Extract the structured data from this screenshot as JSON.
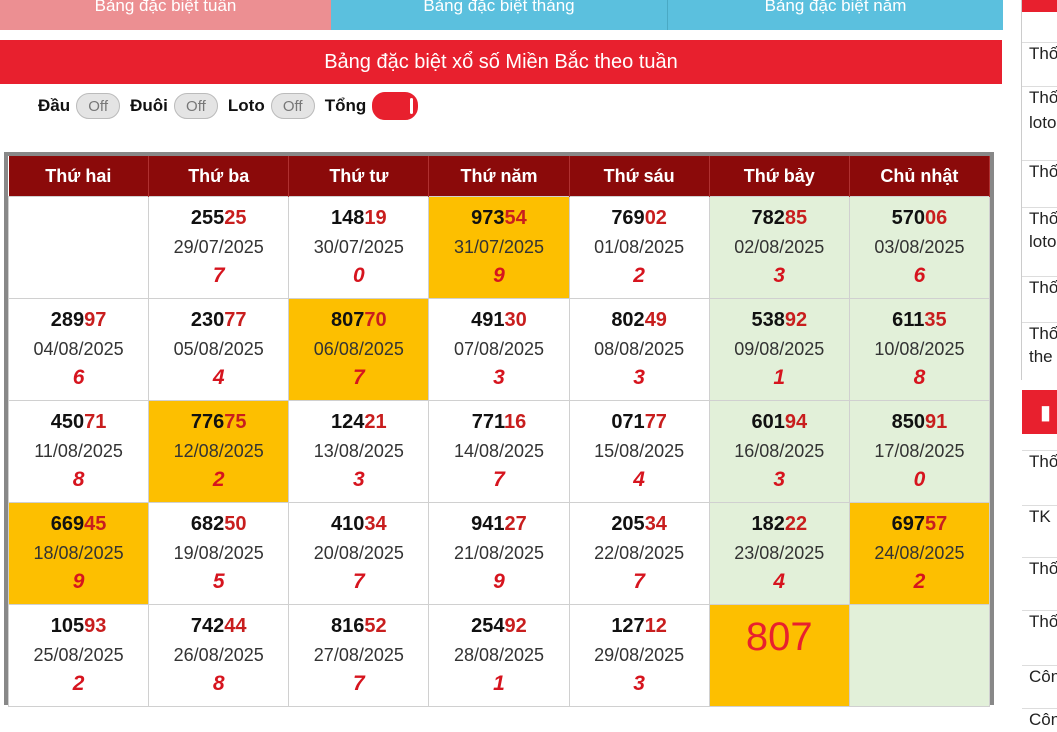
{
  "tabs": [
    {
      "label": "Bảng đặc biệt tuần"
    },
    {
      "label": "Bảng đặc biệt tháng"
    },
    {
      "label": "Bảng đặc biệt năm"
    }
  ],
  "title": "Bảng đặc biệt xổ số Miền Bắc theo tuần",
  "toggles": {
    "dau": {
      "label": "Đầu",
      "state": "Off"
    },
    "duoi": {
      "label": "Đuôi",
      "state": "Off"
    },
    "loto": {
      "label": "Loto",
      "state": "Off"
    },
    "tong": {
      "label": "Tổng",
      "state": "On"
    }
  },
  "headers": [
    "Thứ hai",
    "Thứ ba",
    "Thứ tư",
    "Thứ năm",
    "Thứ sáu",
    "Thứ bảy",
    "Chủ nhật"
  ],
  "rows": [
    [
      {
        "empty": true
      },
      {
        "head": "255",
        "tail": "25",
        "date": "29/07/2025",
        "sum": "7"
      },
      {
        "head": "148",
        "tail": "19",
        "date": "30/07/2025",
        "sum": "0"
      },
      {
        "head": "973",
        "tail": "54",
        "date": "31/07/2025",
        "sum": "9",
        "hl": true
      },
      {
        "head": "769",
        "tail": "02",
        "date": "01/08/2025",
        "sum": "2"
      },
      {
        "head": "782",
        "tail": "85",
        "date": "02/08/2025",
        "sum": "3"
      },
      {
        "head": "570",
        "tail": "06",
        "date": "03/08/2025",
        "sum": "6"
      }
    ],
    [
      {
        "head": "289",
        "tail": "97",
        "date": "04/08/2025",
        "sum": "6"
      },
      {
        "head": "230",
        "tail": "77",
        "date": "05/08/2025",
        "sum": "4"
      },
      {
        "head": "807",
        "tail": "70",
        "date": "06/08/2025",
        "sum": "7",
        "hl": true
      },
      {
        "head": "491",
        "tail": "30",
        "date": "07/08/2025",
        "sum": "3"
      },
      {
        "head": "802",
        "tail": "49",
        "date": "08/08/2025",
        "sum": "3"
      },
      {
        "head": "538",
        "tail": "92",
        "date": "09/08/2025",
        "sum": "1"
      },
      {
        "head": "611",
        "tail": "35",
        "date": "10/08/2025",
        "sum": "8"
      }
    ],
    [
      {
        "head": "450",
        "tail": "71",
        "date": "11/08/2025",
        "sum": "8"
      },
      {
        "head": "776",
        "tail": "75",
        "date": "12/08/2025",
        "sum": "2",
        "hl": true
      },
      {
        "head": "124",
        "tail": "21",
        "date": "13/08/2025",
        "sum": "3"
      },
      {
        "head": "771",
        "tail": "16",
        "date": "14/08/2025",
        "sum": "7"
      },
      {
        "head": "071",
        "tail": "77",
        "date": "15/08/2025",
        "sum": "4"
      },
      {
        "head": "601",
        "tail": "94",
        "date": "16/08/2025",
        "sum": "3"
      },
      {
        "head": "850",
        "tail": "91",
        "date": "17/08/2025",
        "sum": "0"
      }
    ],
    [
      {
        "head": "669",
        "tail": "45",
        "date": "18/08/2025",
        "sum": "9",
        "hl": true
      },
      {
        "head": "682",
        "tail": "50",
        "date": "19/08/2025",
        "sum": "5"
      },
      {
        "head": "410",
        "tail": "34",
        "date": "20/08/2025",
        "sum": "7"
      },
      {
        "head": "941",
        "tail": "27",
        "date": "21/08/2025",
        "sum": "9"
      },
      {
        "head": "205",
        "tail": "34",
        "date": "22/08/2025",
        "sum": "7"
      },
      {
        "head": "182",
        "tail": "22",
        "date": "23/08/2025",
        "sum": "4"
      },
      {
        "head": "697",
        "tail": "57",
        "date": "24/08/2025",
        "sum": "2",
        "hl": true
      }
    ],
    [
      {
        "head": "105",
        "tail": "93",
        "date": "25/08/2025",
        "sum": "2"
      },
      {
        "head": "742",
        "tail": "44",
        "date": "26/08/2025",
        "sum": "8"
      },
      {
        "head": "816",
        "tail": "52",
        "date": "27/08/2025",
        "sum": "7"
      },
      {
        "head": "254",
        "tail": "92",
        "date": "28/08/2025",
        "sum": "1"
      },
      {
        "head": "127",
        "tail": "12",
        "date": "29/08/2025",
        "sum": "3"
      },
      {
        "big": "807",
        "hl": true
      },
      {
        "empty": true
      }
    ]
  ],
  "sidebar": {
    "items": [
      "Thố",
      "Thố",
      "loto",
      "Thố",
      "Thố",
      "loto",
      "Thố",
      "Thố",
      "the",
      "Thố",
      "TK",
      "Thố",
      "Thố",
      "Côn",
      "Côn"
    ]
  },
  "colors": {
    "red": "#e8202e",
    "header": "#8b0a0a",
    "highlight": "#fdbf00",
    "weekend": "#e2f0d9",
    "tab_active": "#ec8f92",
    "tab": "#5bc0de"
  }
}
